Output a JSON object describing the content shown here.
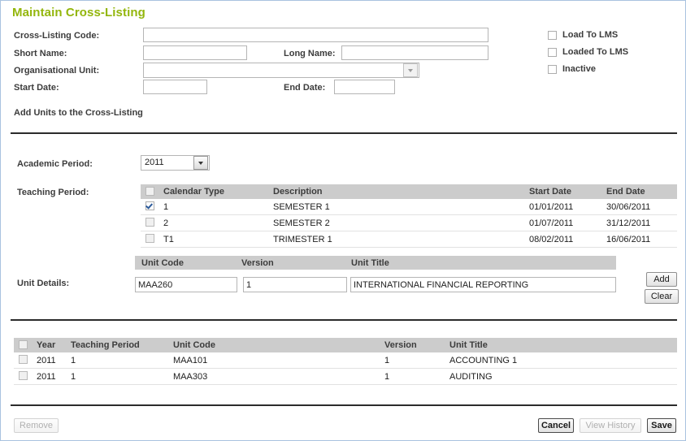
{
  "page": {
    "title": "Maintain Cross-Listing",
    "title_color": "#93b60c",
    "border_color": "#a9c3e0"
  },
  "header_form": {
    "fields": [
      {
        "label": "Cross-Listing Code:",
        "value": "",
        "placeholder": ""
      },
      {
        "label": "Short Name:",
        "value": "",
        "placeholder": ""
      },
      {
        "label": "Long Name:",
        "value": "",
        "placeholder": ""
      },
      {
        "label": "Organisational Unit:",
        "value": "",
        "placeholder": ""
      },
      {
        "label": "Start Date:",
        "value": "",
        "placeholder": ""
      },
      {
        "label": "End Date:",
        "value": "",
        "placeholder": ""
      }
    ],
    "checkboxes": [
      {
        "label": "Load To LMS",
        "checked": false
      },
      {
        "label": "Loaded To LMS",
        "checked": false
      },
      {
        "label": "Inactive",
        "checked": false
      }
    ]
  },
  "add_units": {
    "heading": "Add Units to the Cross-Listing",
    "academic_period": {
      "label": "Academic Period:",
      "value": "2011",
      "options": [
        "2011"
      ]
    },
    "teaching_period": {
      "label": "Teaching Period:",
      "columns": [
        "Calendar Type",
        "Description",
        "Start Date",
        "End Date"
      ],
      "select_all_checked": false,
      "rows": [
        {
          "checked": true,
          "calendar_type": "1",
          "description": "SEMESTER 1",
          "start_date": "01/01/2011",
          "end_date": "30/06/2011"
        },
        {
          "checked": false,
          "calendar_type": "2",
          "description": "SEMESTER 2",
          "start_date": "01/07/2011",
          "end_date": "31/12/2011"
        },
        {
          "checked": false,
          "calendar_type": "T1",
          "description": "TRIMESTER 1",
          "start_date": "08/02/2011",
          "end_date": "16/06/2011"
        }
      ]
    },
    "unit_details": {
      "label": "Unit Details:",
      "columns": [
        "Unit Code",
        "Version",
        "Unit Title"
      ],
      "unit_code": "MAA260",
      "version": "1",
      "unit_title": "INTERNATIONAL FINANCIAL REPORTING",
      "add_label": "Add",
      "clear_label": "Clear"
    }
  },
  "results_grid": {
    "columns": [
      "Year",
      "Teaching Period",
      "Unit Code",
      "Version",
      "Unit Title"
    ],
    "select_all_checked": false,
    "rows": [
      {
        "checked": false,
        "year": "2011",
        "teaching_period": "1",
        "unit_code": "MAA101",
        "version": "1",
        "unit_title": "ACCOUNTING 1"
      },
      {
        "checked": false,
        "year": "2011",
        "teaching_period": "1",
        "unit_code": "MAA303",
        "version": "1",
        "unit_title": "AUDITING"
      }
    ]
  },
  "footer": {
    "remove_label": "Remove",
    "remove_disabled": true,
    "cancel_label": "Cancel",
    "view_history_label": "View History",
    "view_history_disabled": true,
    "save_label": "Save"
  }
}
